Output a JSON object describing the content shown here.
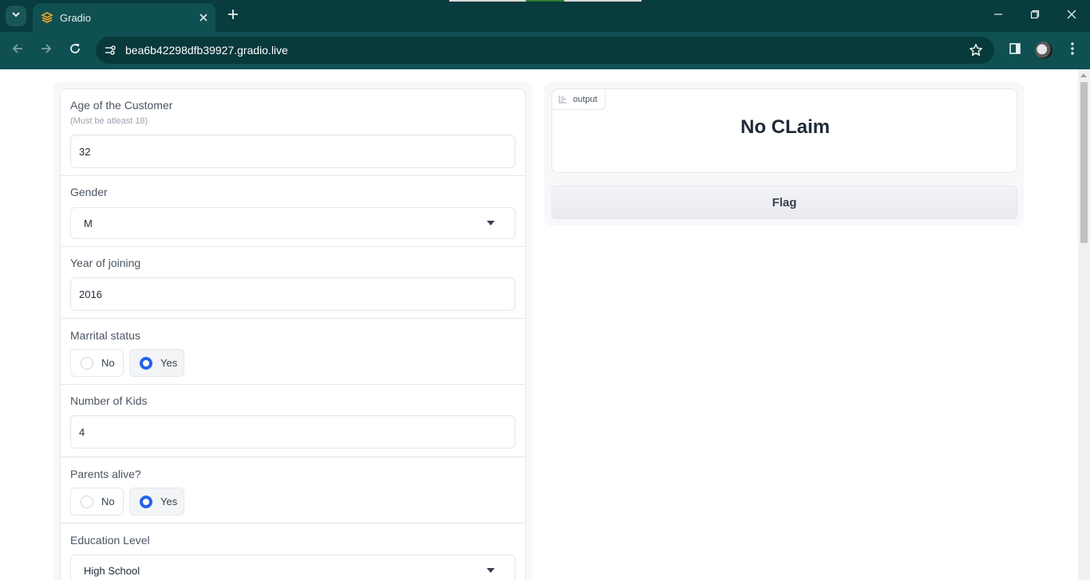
{
  "browser": {
    "tab": {
      "title": "Gradio",
      "favicon": "gradio-logo-icon"
    },
    "url": "bea6b42298dfb39927.gradio.live",
    "icons": [
      "tab-search-icon",
      "close-icon",
      "plus-icon",
      "minimize-icon",
      "restore-icon",
      "close-window-icon",
      "back-icon",
      "forward-icon",
      "reload-icon",
      "site-info-icon",
      "star-icon",
      "side-panel-icon",
      "profile-avatar",
      "more-menu-icon"
    ]
  },
  "form": {
    "age": {
      "label": "Age of the Customer",
      "info": "(Must be atleast 18)",
      "value": "32"
    },
    "gender": {
      "label": "Gender",
      "value": "M"
    },
    "year_joining": {
      "label": "Year of joining",
      "value": "2016"
    },
    "marital": {
      "label": "Marrital status",
      "options": [
        "No",
        "Yes"
      ],
      "selected": "Yes"
    },
    "kids": {
      "label": "Number of Kids",
      "value": "4"
    },
    "parents": {
      "label": "Parents alive?",
      "options": [
        "No",
        "Yes"
      ],
      "selected": "Yes"
    },
    "education": {
      "label": "Education Level",
      "value": "High School"
    }
  },
  "output": {
    "label": "output",
    "value": "No CLaim",
    "flag_label": "Flag"
  },
  "colors": {
    "chrome_dark": "#083c3e",
    "chrome_toolbar": "#0f5053",
    "radio_accent": "#2563eb"
  }
}
